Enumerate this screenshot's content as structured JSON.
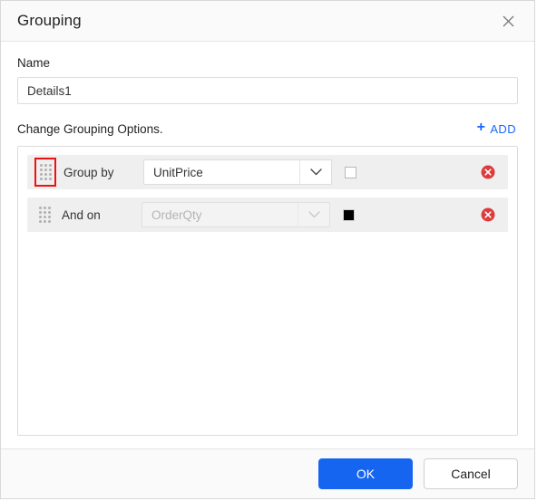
{
  "dialog": {
    "title": "Grouping",
    "close_icon": "close-icon"
  },
  "name_field": {
    "label": "Name",
    "value": "Details1",
    "placeholder": "Name"
  },
  "grouping_section": {
    "title": "Change Grouping Options.",
    "add_label": "ADD",
    "add_plus": "+",
    "rows": [
      {
        "label": "Group by",
        "field_value": "UnitPrice",
        "field_disabled": false,
        "checkbox_state": "unchecked",
        "handle_highlighted": true,
        "delete_icon": "delete-circle-icon"
      },
      {
        "label": "And on",
        "field_value": "OrderQty",
        "field_disabled": true,
        "checkbox_state": "filled",
        "handle_highlighted": false,
        "delete_icon": "delete-circle-icon"
      }
    ]
  },
  "footer": {
    "ok_label": "OK",
    "cancel_label": "Cancel"
  },
  "colors": {
    "primary": "#1565f0",
    "link": "#1a66ff",
    "danger": "#dd3c3c",
    "highlight": "#ee1111"
  }
}
